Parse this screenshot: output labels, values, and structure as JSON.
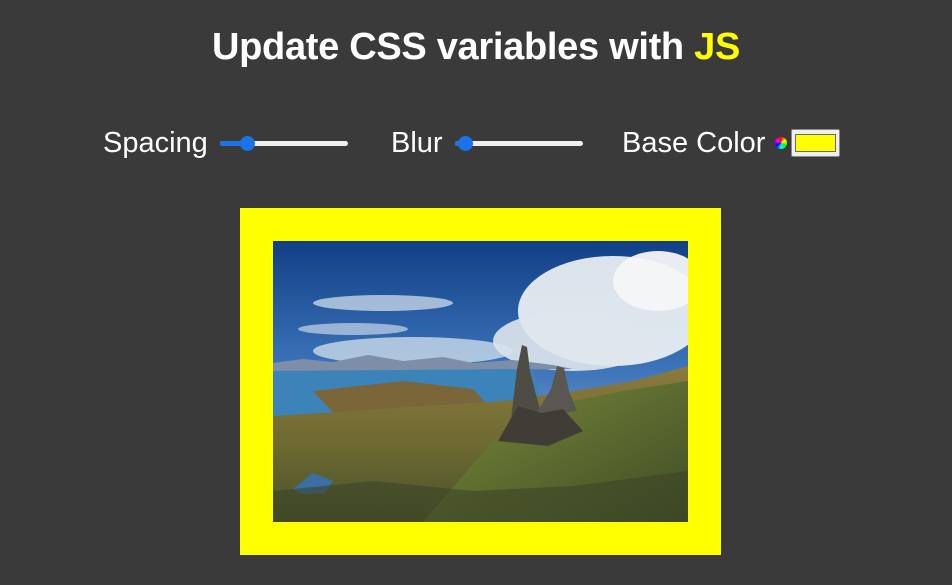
{
  "title": {
    "prefix": "Update CSS variables with ",
    "highlight": "JS"
  },
  "controls": {
    "spacing": {
      "label": "Spacing",
      "value": 10,
      "min": 10,
      "max": 200
    },
    "blur": {
      "label": "Blur",
      "value": 0,
      "min": 0,
      "max": 25
    },
    "base_color": {
      "label": "Base Color",
      "value": "#ffff00",
      "icon": "color-wheel-icon"
    }
  },
  "colors": {
    "background": "#3a3a3a",
    "accent": "#ffff00",
    "slider": "#1a73e8"
  },
  "image": {
    "subject": "landscape-photo"
  }
}
